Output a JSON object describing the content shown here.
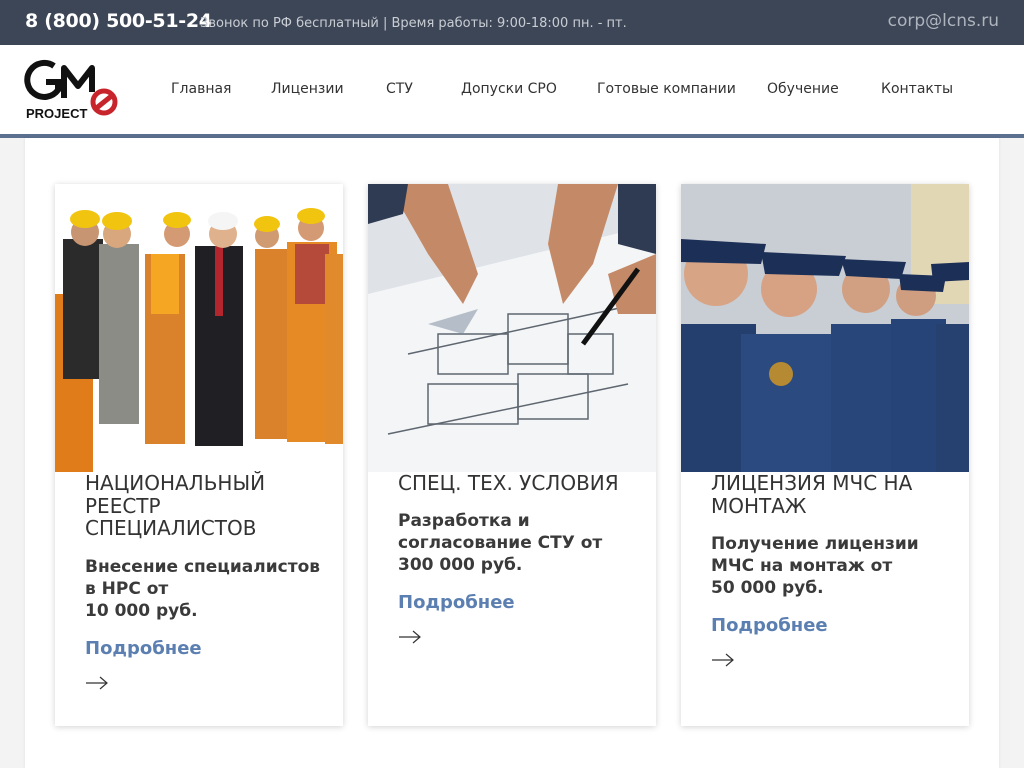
{
  "topbar": {
    "phone": "8 (800) 500-51-24",
    "hours": "Звонок по РФ бесплатный | Время работы: 9:00-18:00 пн. - пт.",
    "email": "corp@lcns.ru"
  },
  "logo": {
    "letters": "GM",
    "project": "PROJECT"
  },
  "nav": [
    "Главная",
    "Лицензии",
    "СТУ",
    "Допуски СРО",
    "Готовые компании",
    "Обучение",
    "Контакты"
  ],
  "cards": [
    {
      "title": "НАЦИОНАЛЬНЫЙ РЕЕСТР СПЕЦИАЛИСТОВ",
      "desc_line1": "Внесение специалистов в НРС от",
      "desc_line2": "10 000 руб.",
      "more": "Подробнее",
      "image": "construction-workers-photo"
    },
    {
      "title": "СПЕЦ. ТЕХ. УСЛОВИЯ",
      "desc_line1": "Разработка и согласование СТУ от",
      "desc_line2": "300 000 руб.",
      "more": "Подробнее",
      "image": "blueprint-plans-photo"
    },
    {
      "title": "ЛИЦЕНЗИЯ МЧС НА МОНТАЖ",
      "desc_line1": "Получение лицензии МЧС на монтаж от",
      "desc_line2": "50 000 руб.",
      "more": "Подробнее",
      "image": "emergency-officers-photo"
    }
  ],
  "colors": {
    "topbar": "#3d4656",
    "header_line": "#5b6f8e",
    "link": "#5b7fb0",
    "logo_red": "#c8242b"
  }
}
